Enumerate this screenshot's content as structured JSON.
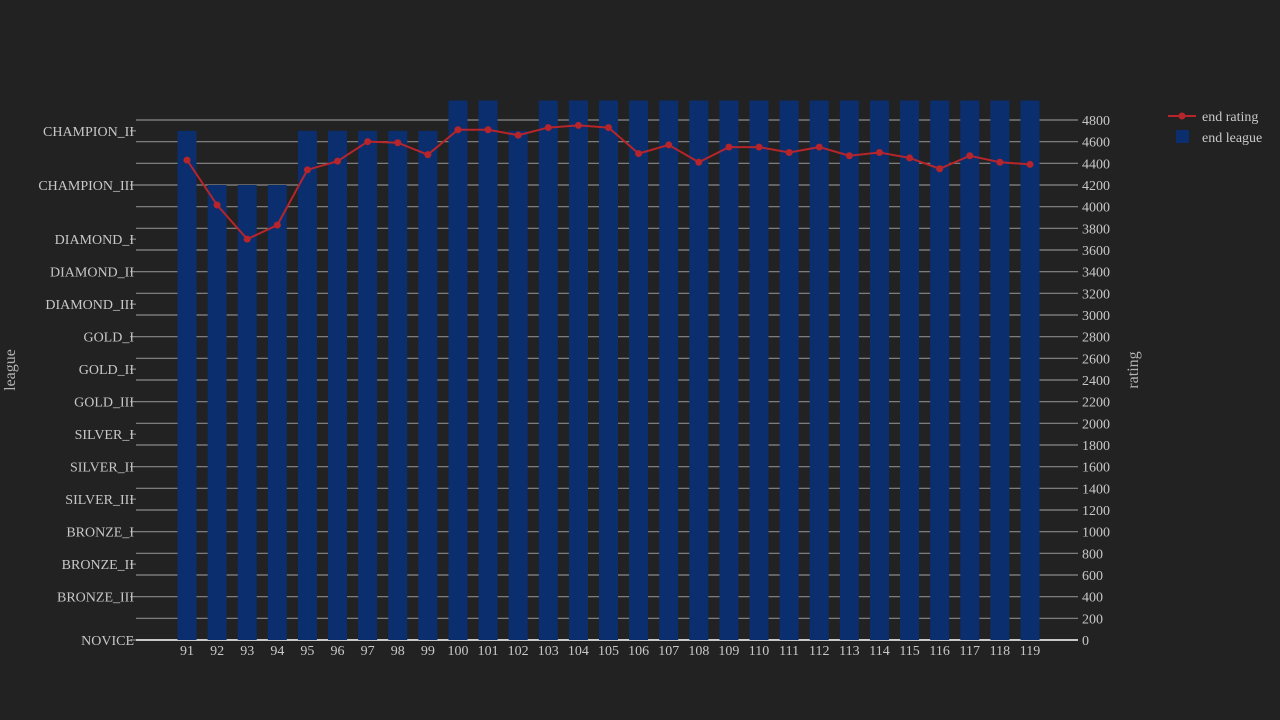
{
  "chart_data": {
    "type": "bar+line",
    "title": "",
    "x": [
      91,
      92,
      93,
      94,
      95,
      96,
      97,
      98,
      99,
      100,
      101,
      102,
      103,
      104,
      105,
      106,
      107,
      108,
      109,
      110,
      111,
      112,
      113,
      114,
      115,
      116,
      117,
      118,
      119
    ],
    "xtick_labels": [
      "91",
      "92",
      "93",
      "94",
      "95",
      "96",
      "97",
      "98",
      "99",
      "100",
      "101",
      "102",
      "103",
      "104",
      "105",
      "106",
      "107",
      "108",
      "109",
      "110",
      "111",
      "112",
      "113",
      "114",
      "115",
      "116",
      "117",
      "118",
      "119"
    ],
    "series": [
      {
        "name": "end league",
        "type": "bar",
        "axis": "left",
        "color": "#0b2f6e",
        "values": [
          "CHAMPION_II",
          "CHAMPION_III",
          "CHAMPION_III",
          "CHAMPION_III",
          "CHAMPION_II",
          "CHAMPION_II",
          "CHAMPION_II",
          "CHAMPION_II",
          "CHAMPION_II",
          "CHAMPION_I",
          "CHAMPION_I",
          "CHAMPION_II",
          "CHAMPION_I",
          "CHAMPION_I",
          "CHAMPION_I",
          "CHAMPION_I",
          "CHAMPION_I",
          "CHAMPION_I",
          "CHAMPION_I",
          "CHAMPION_I",
          "CHAMPION_I",
          "CHAMPION_I",
          "CHAMPION_I",
          "CHAMPION_I",
          "CHAMPION_I",
          "CHAMPION_I",
          "CHAMPION_I",
          "CHAMPION_I",
          "CHAMPION_I"
        ]
      },
      {
        "name": "end rating",
        "type": "line",
        "axis": "right",
        "color": "#b5252b",
        "values": [
          4430,
          4015,
          3700,
          3830,
          4340,
          4420,
          4600,
          4590,
          4480,
          4710,
          4710,
          4660,
          4730,
          4750,
          4730,
          4490,
          4570,
          4410,
          4550,
          4550,
          4500,
          4550,
          4470,
          4500,
          4450,
          4350,
          4470,
          4410,
          4390
        ]
      }
    ],
    "left_axis": {
      "title": "league",
      "categories": [
        "NOVICE",
        "BRONZE_III",
        "BRONZE_II",
        "BRONZE_I",
        "SILVER_III",
        "SILVER_II",
        "SILVER_I",
        "GOLD_III",
        "GOLD_II",
        "GOLD_I",
        "DIAMOND_III",
        "DIAMOND_II",
        "DIAMOND_I",
        "CHAMPION_III",
        "CHAMPION_II"
      ],
      "category_ratings": [
        0,
        400,
        700,
        1000,
        1300,
        1600,
        1900,
        2200,
        2500,
        2800,
        3100,
        3400,
        3700,
        4200,
        4700
      ],
      "clipped_categories": {
        "CHAMPION_I": 4980
      }
    },
    "right_axis": {
      "title": "rating",
      "range": [
        0,
        4800
      ],
      "ticks": [
        0,
        200,
        400,
        600,
        800,
        1000,
        1200,
        1400,
        1600,
        1800,
        2000,
        2200,
        2400,
        2600,
        2800,
        3000,
        3200,
        3400,
        3600,
        3800,
        4000,
        4200,
        4400,
        4600,
        4800
      ]
    },
    "grid": true,
    "legend": {
      "position": "top-right",
      "entries": [
        "end rating",
        "end league"
      ]
    }
  }
}
